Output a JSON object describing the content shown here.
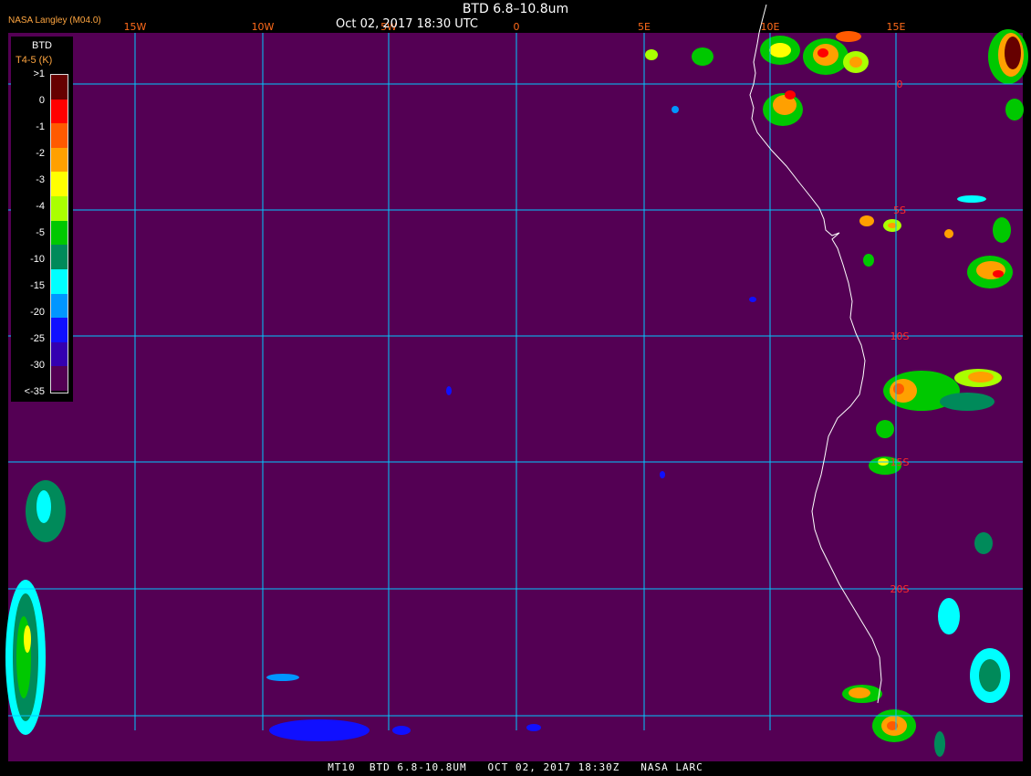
{
  "header": {
    "title": "BTD 6.8–10.8um",
    "datetime": "Oct 02, 2017 18:30 UTC",
    "credit": "NASA Langley (M04.0)"
  },
  "footer": {
    "text": "MT10  BTD 6.8-10.8UM   OCT 02, 2017 18:30Z   NASA LARC"
  },
  "map": {
    "background_color": "#540054",
    "grid_color": "#00c8ff",
    "coast_color": "#ffffff",
    "lon_labels": [
      "15W",
      "10W",
      "5W",
      "0",
      "5E",
      "10E",
      "15E"
    ],
    "lat_labels": [
      "0",
      "5S",
      "10S",
      "15S",
      "20S"
    ],
    "lon_label_color": "#ff6a1a",
    "lat_label_color": "#ff2a2a"
  },
  "legend": {
    "title": "BTD",
    "subtitle": "T4-5 (K)",
    "labels": [
      ">1",
      "0",
      "-1",
      "-2",
      "-3",
      "-4",
      "-5",
      "-10",
      "-15",
      "-20",
      "-25",
      "-30",
      "<-35"
    ],
    "colors": [
      "#660000",
      "#ff0000",
      "#ff5a00",
      "#ffa000",
      "#ffff00",
      "#aaff00",
      "#00c800",
      "#008a5a",
      "#00ffff",
      "#0096ff",
      "#1010ff",
      "#3400b0",
      "#540054"
    ]
  }
}
